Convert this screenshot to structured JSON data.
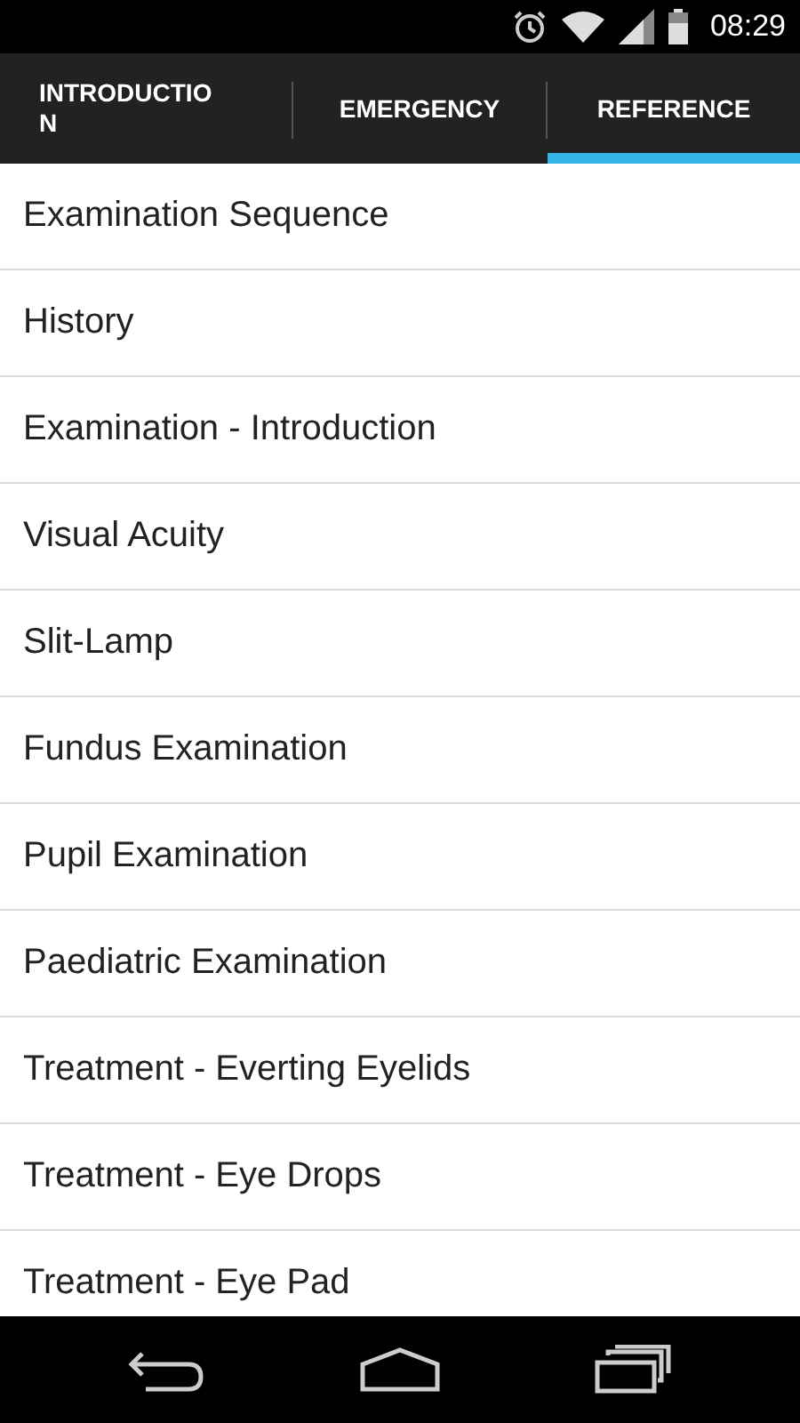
{
  "status_bar": {
    "time": "08:29"
  },
  "tabs": [
    {
      "label": "INTRODUCTION",
      "selected": false
    },
    {
      "label": "EMERGENCY",
      "selected": false
    },
    {
      "label": "REFERENCE",
      "selected": true
    }
  ],
  "list": {
    "items": [
      "Examination Sequence",
      "History",
      "Examination - Introduction",
      "Visual Acuity",
      "Slit-Lamp",
      "Fundus Examination",
      "Pupil Examination",
      "Paediatric Examination",
      "Treatment - Everting Eyelids",
      "Treatment - Eye Drops",
      "Treatment - Eye Pad"
    ]
  }
}
